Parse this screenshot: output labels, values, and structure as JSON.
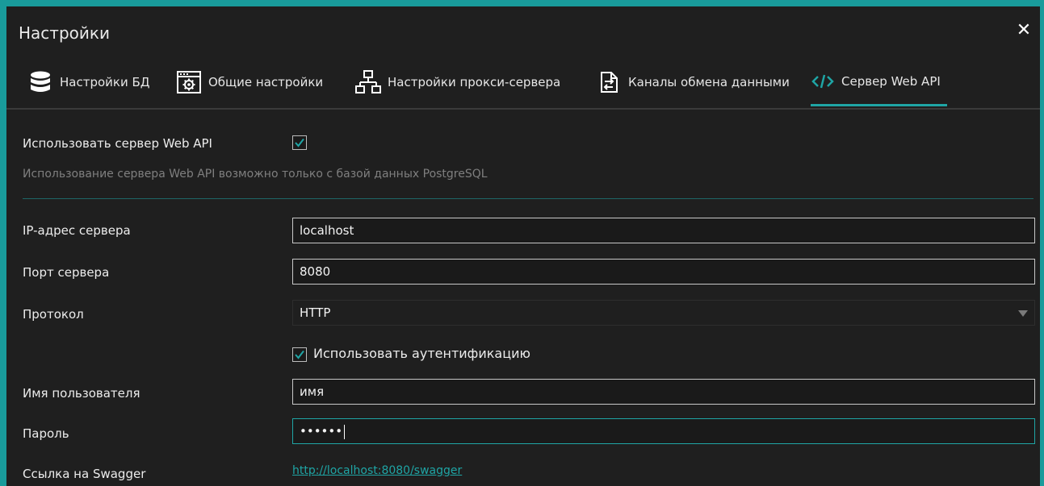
{
  "window": {
    "title": "Настройки"
  },
  "tabs": [
    {
      "label": "Настройки БД",
      "icon": "database-icon"
    },
    {
      "label": "Общие настройки",
      "icon": "settings-window-icon"
    },
    {
      "label": "Настройки прокси-сервера",
      "icon": "network-icon"
    },
    {
      "label": "Каналы обмена данными",
      "icon": "data-exchange-icon"
    },
    {
      "label": "Сервер Web API",
      "icon": "code-icon",
      "active": true
    }
  ],
  "form": {
    "use_webapi_label": "Использовать сервер Web API",
    "use_webapi_checked": true,
    "hint": "Использование сервера Web API возможно только с базой данных PostgreSQL",
    "ip_label": "IP-адрес сервера",
    "ip_value": "localhost",
    "port_label": "Порт сервера",
    "port_value": "8080",
    "protocol_label": "Протокол",
    "protocol_value": "HTTP",
    "auth_label": "Использовать аутентификацию",
    "auth_checked": true,
    "username_label": "Имя пользователя",
    "username_value": "имя",
    "password_label": "Пароль",
    "password_value": "••••••",
    "swagger_label": "Ссылка на Swagger",
    "swagger_link": "http://localhost:8080/swagger"
  },
  "colors": {
    "accent": "#1fa5a5",
    "frame": "#199b9b",
    "background": "#1f1f1f"
  }
}
